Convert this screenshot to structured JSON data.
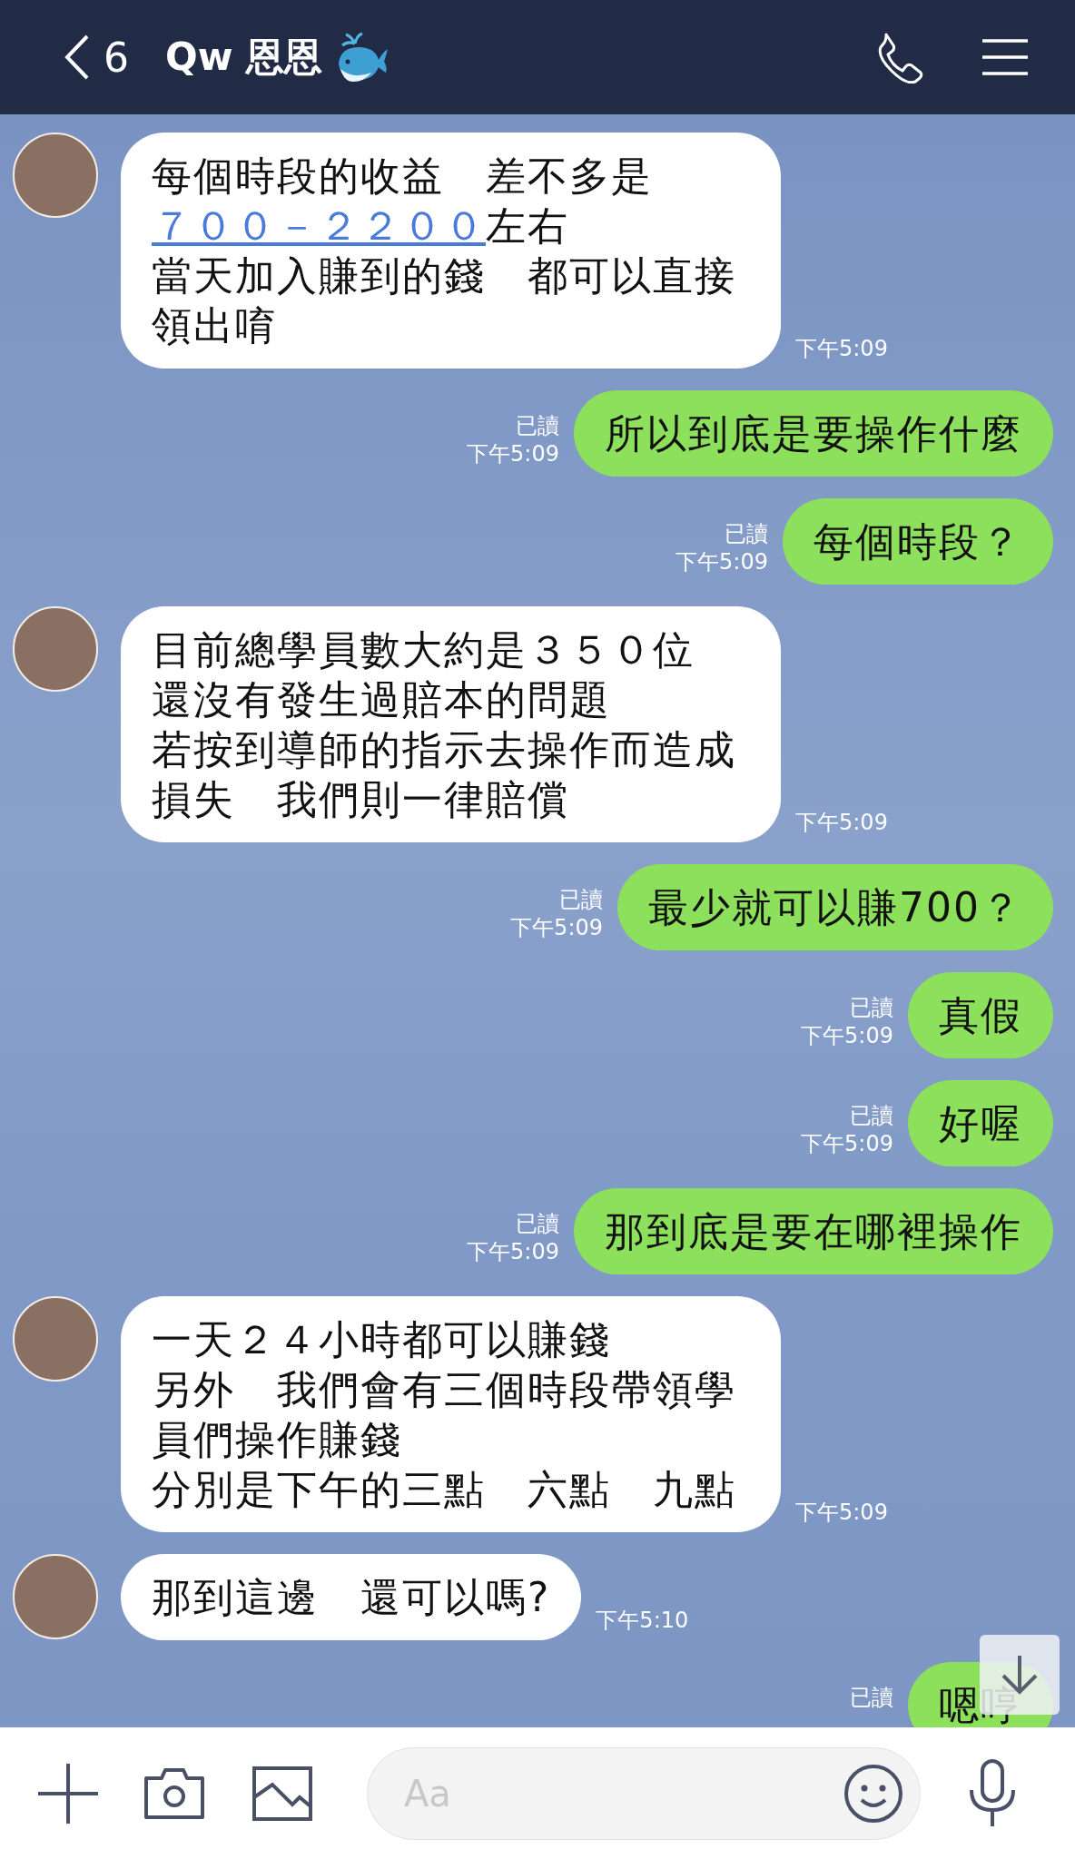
{
  "header": {
    "back_count": "6",
    "title": "Qw 恩恩"
  },
  "messages": [
    {
      "kind": "incoming",
      "lines": [
        [
          {
            "kind": "text",
            "text": "每個時段的收益　差不多是"
          },
          {
            "kind": "link",
            "text": "７００－２２００"
          },
          {
            "kind": "text",
            "text": "左右"
          }
        ],
        [
          {
            "kind": "text",
            "text": "當天加入賺到的錢　都可以直接領出唷"
          }
        ]
      ],
      "time": "下午5:09"
    },
    {
      "kind": "outgoing",
      "lines": [
        [
          {
            "kind": "text",
            "text": "所以到底是要操作什麼"
          }
        ]
      ],
      "read": "已讀",
      "time": "下午5:09"
    },
    {
      "kind": "outgoing",
      "lines": [
        [
          {
            "kind": "text",
            "text": "每個時段？"
          }
        ]
      ],
      "read": "已讀",
      "time": "下午5:09"
    },
    {
      "kind": "incoming",
      "lines": [
        [
          {
            "kind": "text",
            "text": "目前總學員數大約是３５０位"
          }
        ],
        [
          {
            "kind": "text",
            "text": "還沒有發生過賠本的問題"
          }
        ],
        [
          {
            "kind": "text",
            "text": "若按到導師的指示去操作而造成損失　我們則一律賠償"
          }
        ]
      ],
      "time": "下午5:09"
    },
    {
      "kind": "outgoing",
      "lines": [
        [
          {
            "kind": "text",
            "text": "最少就可以賺700？"
          }
        ]
      ],
      "read": "已讀",
      "time": "下午5:09"
    },
    {
      "kind": "outgoing",
      "lines": [
        [
          {
            "kind": "text",
            "text": "真假"
          }
        ]
      ],
      "read": "已讀",
      "time": "下午5:09"
    },
    {
      "kind": "outgoing",
      "lines": [
        [
          {
            "kind": "text",
            "text": "好喔"
          }
        ]
      ],
      "read": "已讀",
      "time": "下午5:09"
    },
    {
      "kind": "outgoing",
      "lines": [
        [
          {
            "kind": "text",
            "text": "那到底是要在哪裡操作"
          }
        ]
      ],
      "read": "已讀",
      "time": "下午5:09"
    },
    {
      "kind": "incoming",
      "lines": [
        [
          {
            "kind": "text",
            "text": "一天２４小時都可以賺錢"
          }
        ],
        [
          {
            "kind": "text",
            "text": "另外　我們會有三個時段帶領學員們操作賺錢"
          }
        ],
        [
          {
            "kind": "text",
            "text": "分別是下午的三點　六點　九點"
          }
        ]
      ],
      "time": "下午5:09"
    },
    {
      "kind": "incoming",
      "lines": [
        [
          {
            "kind": "text",
            "text": "那到這邊　還可以嗎?"
          }
        ]
      ],
      "time": "下午5:10"
    },
    {
      "kind": "outgoing",
      "lines": [
        [
          {
            "kind": "text",
            "text": "嗯哼"
          }
        ]
      ],
      "read": "已讀"
    }
  ],
  "input": {
    "placeholder": "Aa"
  }
}
